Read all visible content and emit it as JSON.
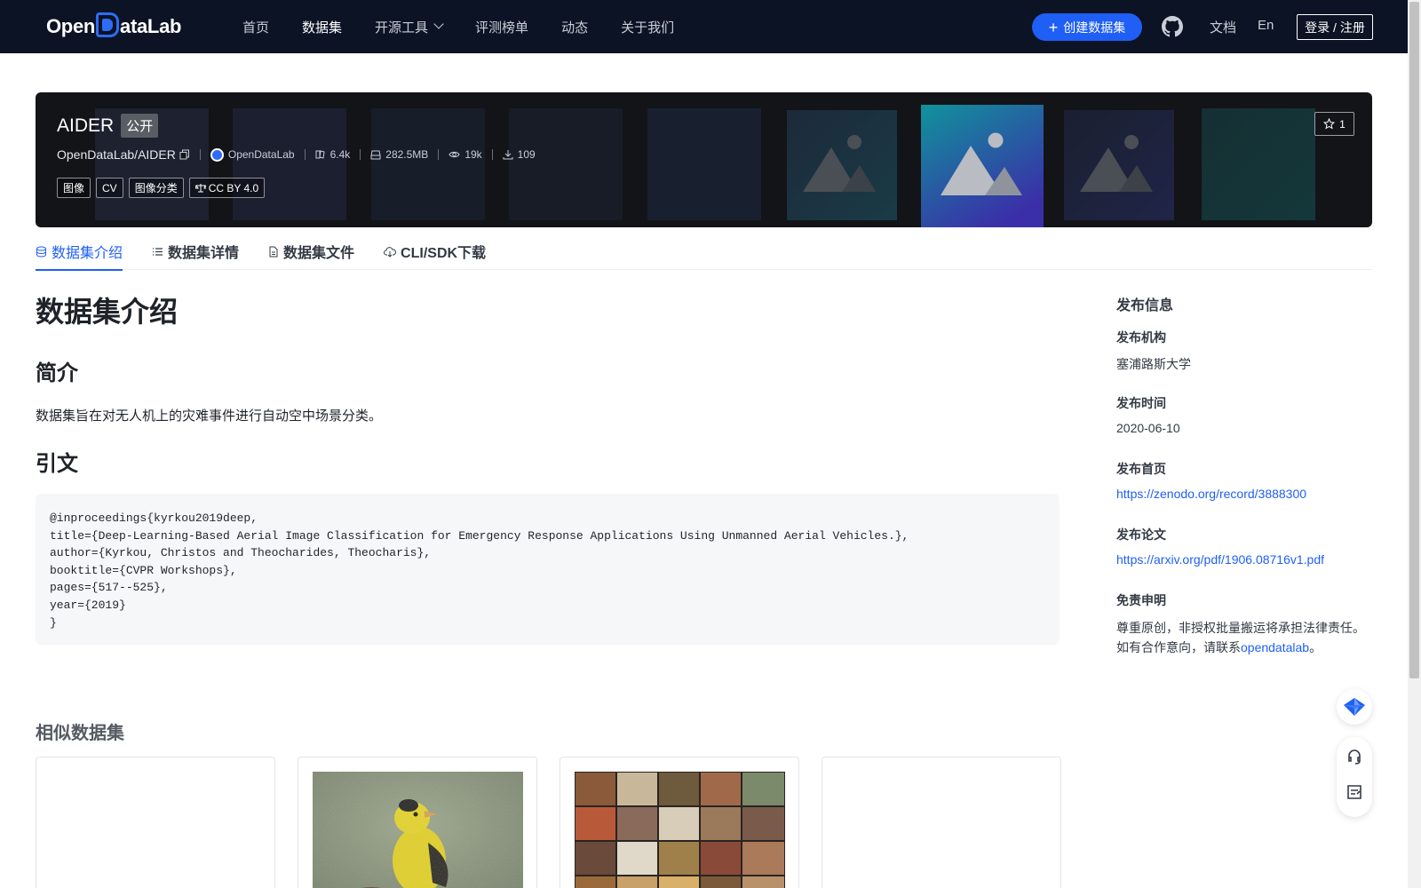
{
  "nav": {
    "logo_text_left": "Open",
    "logo_text_right": "ataLab",
    "items": [
      {
        "label": "首页",
        "active": false
      },
      {
        "label": "数据集",
        "active": true
      },
      {
        "label": "开源工具",
        "active": false,
        "dropdown": true
      },
      {
        "label": "评测榜单",
        "active": false
      },
      {
        "label": "动态",
        "active": false
      },
      {
        "label": "关于我们",
        "active": false
      }
    ],
    "create_label": "创建数据集",
    "docs_label": "文档",
    "lang_label": "En",
    "login_label": "登录 / 注册"
  },
  "dataset": {
    "title": "AIDER",
    "visibility": "公开",
    "repo": "OpenDataLab/AIDER",
    "org": "OpenDataLab",
    "stats": {
      "files": "6.4k",
      "size": "282.5MB",
      "views": "19k",
      "downloads": "109"
    },
    "tags": [
      "图像",
      "CV",
      "图像分类"
    ],
    "license": "CC BY 4.0",
    "stars": "1"
  },
  "tabs": [
    {
      "label": "数据集介绍",
      "icon": "database-icon",
      "active": true
    },
    {
      "label": "数据集详情",
      "icon": "list-icon",
      "active": false
    },
    {
      "label": "数据集文件",
      "icon": "file-icon",
      "active": false
    },
    {
      "label": "CLI/SDK下载",
      "icon": "cloud-icon",
      "active": false
    }
  ],
  "content": {
    "heading": "数据集介绍",
    "section_intro": "简介",
    "intro_text": "数据集旨在对无人机上的灾难事件进行自动空中场景分类。",
    "section_citation": "引文",
    "citation": "@inproceedings{kyrkou2019deep,\ntitle={Deep-Learning-Based Aerial Image Classification for Emergency Response Applications Using Unmanned Aerial Vehicles.},\nauthor={Kyrkou, Christos and Theocharides, Theocharis},\nbooktitle={CVPR Workshops},\npages={517--525},\nyear={2019}\n}",
    "similar_title": "相似数据集"
  },
  "sidebar": {
    "title": "发布信息",
    "publisher_label": "发布机构",
    "publisher": "塞浦路斯大学",
    "date_label": "发布时间",
    "date": "2020-06-10",
    "homepage_label": "发布首页",
    "homepage": "https://zenodo.org/record/3888300",
    "paper_label": "发布论文",
    "paper": "https://arxiv.org/pdf/1906.08716v1.pdf",
    "disclaimer_label": "免责申明",
    "disclaimer_line1": "尊重原创，非授权批量搬运将承担法律责任。",
    "disclaimer_line2_prefix": "如有合作意向，请联系",
    "disclaimer_link": "opendatalab",
    "disclaimer_line2_suffix": "。"
  },
  "colors": {
    "accent": "#1f5ff5",
    "nav_bg": "#0b1324",
    "banner_bg": "#121418"
  }
}
